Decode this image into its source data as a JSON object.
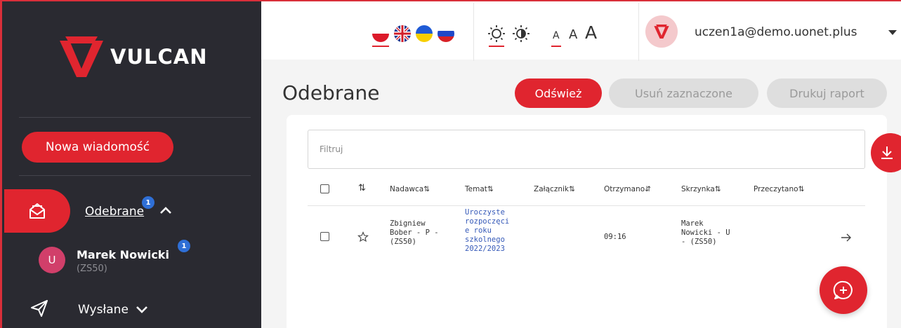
{
  "brand": {
    "name": "VULCAN",
    "accent": "#e0252f",
    "sidebar_bg": "#2a2a31"
  },
  "sidebar": {
    "new_message_label": "Nowa wiadomość",
    "inbox": {
      "label": "Odebrane",
      "badge": "1",
      "icon": "envelope-open-icon",
      "expanded": true
    },
    "mailbox": {
      "avatar_initial": "U",
      "name": "Marek Nowicki",
      "school": "(ZS50)",
      "badge": "1"
    },
    "sent": {
      "label": "Wysłane",
      "icon": "paper-plane-icon",
      "expanded": false
    }
  },
  "topbar": {
    "languages": [
      "pl",
      "en",
      "uk",
      "ru"
    ],
    "selected_language": "pl",
    "contrast": [
      "sun-icon",
      "high-contrast-sun-icon"
    ],
    "font_sizes": [
      "A",
      "A",
      "A"
    ],
    "user_email": "uczen1a@demo.uonet.plus"
  },
  "main": {
    "title": "Odebrane",
    "refresh_label": "Odśwież",
    "delete_label": "Usuń zaznaczone",
    "print_label": "Drukuj raport",
    "filter_placeholder": "Filtruj",
    "columns": {
      "sort": "⇅",
      "sender": "Nadawca⇅",
      "subject": "Temat⇅",
      "attachment": "Załącznik⇅",
      "received": "Otrzymano⇵",
      "mailbox": "Skrzynka⇅",
      "read": "Przeczytano⇅"
    },
    "rows": [
      {
        "sender": [
          "Zbigniew",
          "Bober - P -",
          "(ZS50)"
        ],
        "subject": [
          "Uroczyste",
          "rozpoczęci",
          "e roku",
          "szkolnego",
          "2022/2023"
        ],
        "received": "09:16",
        "mailbox": [
          "Marek",
          "Nowicki - U",
          "- (ZS50)"
        ]
      }
    ]
  }
}
